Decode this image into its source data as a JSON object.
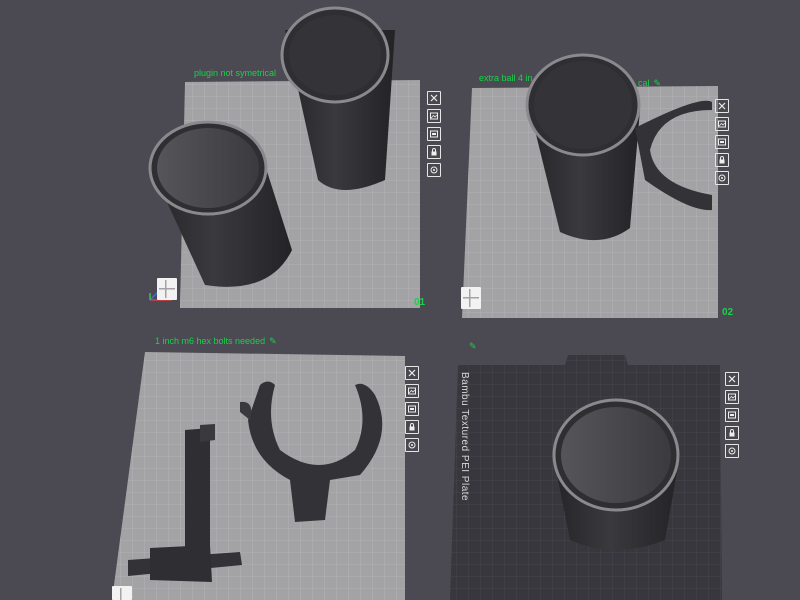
{
  "plates": [
    {
      "number": "01",
      "note": "plugin not symetrical",
      "tool_icons": [
        "close-icon",
        "arrange-icon",
        "orient-icon",
        "lock-icon",
        "settings-icon"
      ]
    },
    {
      "number": "02",
      "note": "extra ball 4 in",
      "note_tail": "cal",
      "tool_icons": [
        "close-icon",
        "arrange-icon",
        "orient-icon",
        "lock-icon",
        "settings-icon"
      ]
    },
    {
      "number": "",
      "note": "1 inch m6 hex bolts needed",
      "tool_icons": [
        "close-icon",
        "arrange-icon",
        "orient-icon",
        "lock-icon",
        "settings-icon"
      ]
    },
    {
      "number": "",
      "note": "",
      "plate_type": "Bambu Textured PEI Plate",
      "tool_icons": [
        "close-icon",
        "arrange-icon",
        "orient-icon",
        "lock-icon",
        "settings-icon"
      ]
    }
  ],
  "edit_glyph": "✎",
  "colors": {
    "background": "#4b4a52",
    "smooth_plate": "#a3a3a5",
    "textured_plate": "#38373d",
    "label_green": "#19d14a",
    "model": "#2d2d30"
  }
}
